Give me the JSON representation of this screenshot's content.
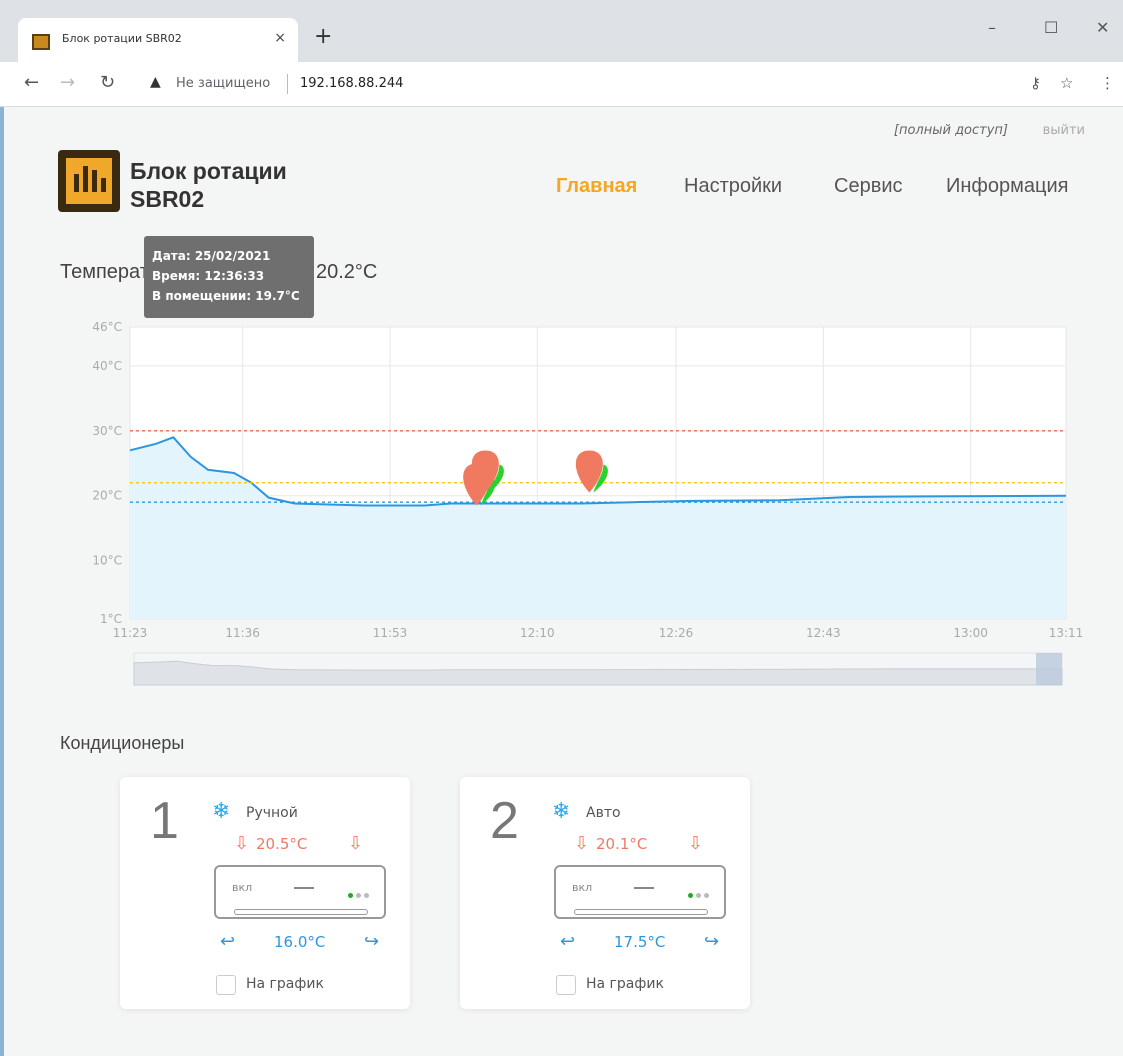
{
  "browser": {
    "tab_title": "Блок ротации SBR02",
    "tab_close": "×",
    "new_tab": "+",
    "security_status": "Не защищено",
    "url": "192.168.88.244"
  },
  "header": {
    "access_label": "[полный доступ]",
    "logout_label": "выйти",
    "brand_line1": "Блок ротации",
    "brand_line2": "SBR02",
    "nav": [
      "Главная",
      "Настройки",
      "Сервис",
      "Информация"
    ],
    "active_nav": "Главная"
  },
  "temperature": {
    "title": "Температура в помещении 20.2°C"
  },
  "chart_data": {
    "type": "area",
    "title": "Температура в помещении 20.2°C",
    "y_ticks": [
      "46°C",
      "40°C",
      "30°C",
      "20°C",
      "10°C",
      "1°C"
    ],
    "y_tick_values": [
      46,
      40,
      30,
      20,
      10,
      1
    ],
    "ylim": [
      1,
      46
    ],
    "x_ticks": [
      "11:23",
      "11:36",
      "11:53",
      "12:10",
      "12:26",
      "12:43",
      "13:00",
      "13:11"
    ],
    "x_tick_minutes": [
      683,
      696,
      713,
      730,
      746,
      763,
      780,
      791
    ],
    "x_range_minutes": [
      683,
      791
    ],
    "series": [
      {
        "color": "#2c96de",
        "points": [
          [
            683,
            27.0
          ],
          [
            686,
            28.0
          ],
          [
            688,
            29.0
          ],
          [
            690,
            26.0
          ],
          [
            692,
            24.0
          ],
          [
            695,
            23.5
          ],
          [
            697,
            22.0
          ],
          [
            699,
            19.7
          ],
          [
            702,
            18.8
          ],
          [
            710,
            18.5
          ],
          [
            717,
            18.5
          ],
          [
            720,
            18.8
          ],
          [
            735,
            18.8
          ],
          [
            741,
            19.0
          ],
          [
            748,
            19.2
          ],
          [
            758,
            19.3
          ],
          [
            766,
            19.8
          ],
          [
            775,
            19.9
          ],
          [
            791,
            20.0
          ]
        ]
      }
    ],
    "reference_lines": [
      {
        "value": 30.0,
        "color": "#e26a56"
      },
      {
        "value": 22.0,
        "color": "#f2c200"
      },
      {
        "value": 19.0,
        "color": "#2c96de"
      }
    ],
    "markers": [
      {
        "x": 723,
        "y": 22.5,
        "color": "#f07a60"
      },
      {
        "x": 724,
        "y": 24.5,
        "color": "#f07a60"
      },
      {
        "x": 736,
        "y": 24.5,
        "color": "#f07a60"
      }
    ],
    "tooltip": {
      "date": "Дата: 25/02/2021",
      "time": "Время: 12:36:33",
      "value": "В помещении: 19.7°C"
    },
    "grid": true
  },
  "conditioners": {
    "title": "Кондиционеры",
    "units": [
      {
        "number": "1",
        "mode": "Ручной",
        "set_temp": "20.5°C",
        "room_temp": "16.0°C",
        "power": "вкл",
        "chart_label": "На график"
      },
      {
        "number": "2",
        "mode": "Авто",
        "set_temp": "20.1°C",
        "room_temp": "17.5°C",
        "power": "вкл",
        "chart_label": "На график"
      }
    ]
  },
  "icons": {
    "snow": "snowflake-icon",
    "arrow_down": "arrow-down-icon",
    "arrow_left_cool": "cool-arrow-left-icon",
    "arrow_right_cool": "cool-arrow-right-icon"
  }
}
